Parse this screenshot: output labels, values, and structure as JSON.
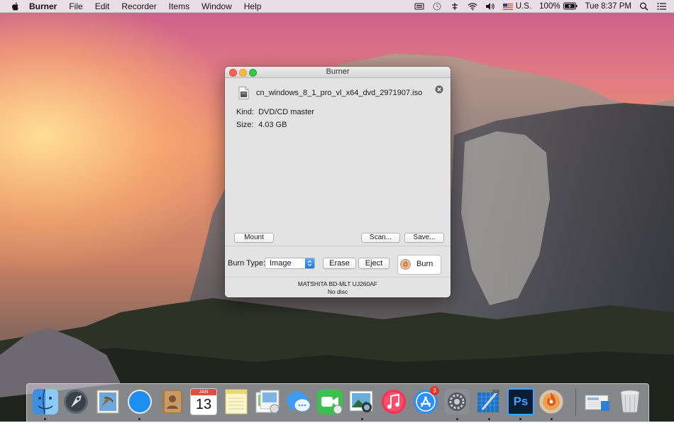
{
  "menubar": {
    "app_name": "Burner",
    "items": [
      "File",
      "Edit",
      "Recorder",
      "Items",
      "Window",
      "Help"
    ],
    "status": {
      "language": "U.S.",
      "battery": "100%",
      "clock": "Tue 8:37 PM"
    }
  },
  "window": {
    "title": "Burner",
    "file_name": "cn_windows_8_1_pro_vl_x64_dvd_2971907.iso",
    "kind_label": "Kind:",
    "kind_value": "DVD/CD master",
    "size_label": "Size:",
    "size_value": "4.03 GB",
    "buttons": {
      "mount": "Mount",
      "scan": "Scan...",
      "save": "Save...",
      "erase": "Erase",
      "eject": "Eject",
      "burn": "Burn"
    },
    "burn_type_label": "Burn Type:",
    "burn_type_value": "Image",
    "drive_name": "MATSHITA BD-MLT UJ260AF",
    "disc_status": "No disc"
  },
  "dock": {
    "calendar_month": "JAN",
    "calendar_day": "13",
    "appstore_badge": "3",
    "photoshop_label": "Ps"
  }
}
